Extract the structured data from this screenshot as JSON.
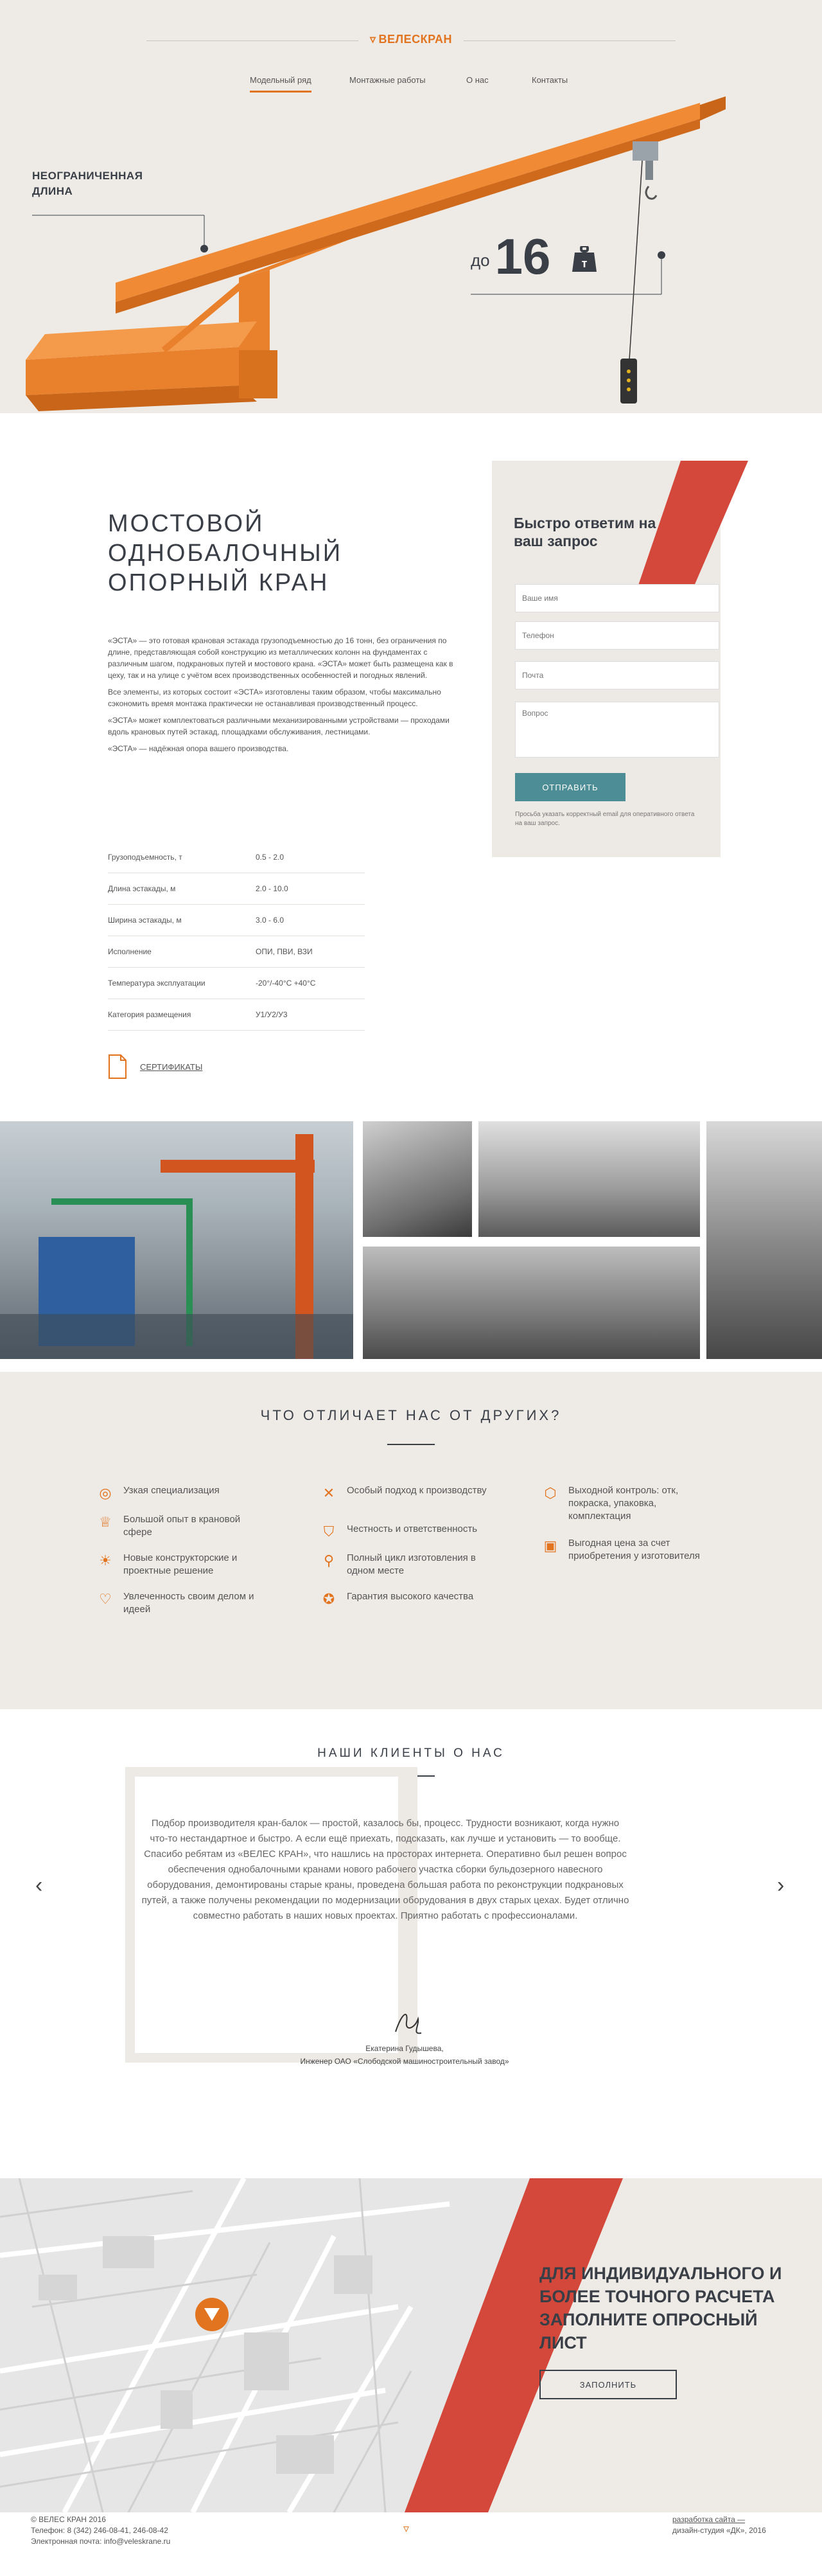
{
  "header": {
    "logo_text": "ВЕЛЕСКРАН",
    "nav": [
      "Модельный ряд",
      "Монтажные работы",
      "О нас",
      "Контакты"
    ]
  },
  "hero": {
    "callout_length": "НЕОГРАНИЧЕННАЯ ДЛИНА",
    "capacity_prefix": "до",
    "capacity_value": "16"
  },
  "product": {
    "title": "МОСТОВОЙ ОДНОБАЛОЧНЫЙ ОПОРНЫЙ КРАН",
    "paragraphs": [
      "«ЭСТА» — это готовая крановая эстакада грузоподъемностью до 16 тонн, без ограничения по длине, представляющая собой конструкцию из металлических колонн на фундаментах с различным шагом, подкрановых путей и мостового крана. «ЭСТА» может быть размещена как в цеху, так и на улице с учётом всех производственных особенностей и погодных явлений.",
      "Все элементы, из которых состоит «ЭСТА» изготовлены таким образом, чтобы максимально сэкономить время монтажа практически не останавливая производственный процесс.",
      "«ЭСТА» может комплектоваться различными механизированными устройствами — проходами вдоль крановых путей эстакад, площадками обслуживания, лестницами.",
      "«ЭСТА» — надёжная опора вашего производства."
    ],
    "specs": [
      {
        "k": "Грузоподъемность, т",
        "v": "0.5 - 2.0"
      },
      {
        "k": "Длина эстакады, м",
        "v": "2.0 - 10.0"
      },
      {
        "k": "Ширина эстакады, м",
        "v": "3.0 - 6.0"
      },
      {
        "k": "Исполнение",
        "v": "ОПИ, ПВИ, ВЗИ"
      },
      {
        "k": "Температура эксплуатации",
        "v": "-20°/-40°С +40°С"
      },
      {
        "k": "Категория размещения",
        "v": "У1/У2/У3"
      }
    ],
    "certificates_label": "СЕРТИФИКАТЫ"
  },
  "form": {
    "title": "Быстро ответим на ваш запрос",
    "name_placeholder": "Ваше имя",
    "phone_placeholder": "Телефон",
    "email_placeholder": "Почта",
    "question_placeholder": "Вопрос",
    "submit_label": "ОТПРАВИТЬ",
    "note": "Просьба указать корректный email для оперативного ответа на ваш запрос."
  },
  "features": {
    "title": "ЧТО ОТЛИЧАЕТ НАС ОТ ДРУГИХ?",
    "items": [
      {
        "text": "Узкая специализация",
        "icon": "target-icon"
      },
      {
        "text": "Большой опыт в крановой сфере",
        "icon": "medal-icon"
      },
      {
        "text": "Новые конструкторские и проектные решение",
        "icon": "bulb-icon"
      },
      {
        "text": "Увлеченность своим делом и идеей",
        "icon": "heart-icon"
      },
      {
        "text": "Особый подход к производству",
        "icon": "tools-icon"
      },
      {
        "text": "Честность и ответственность",
        "icon": "shield-icon"
      },
      {
        "text": "Полный цикл изготовления в одном месте",
        "icon": "location-icon"
      },
      {
        "text": "Гарантия высокого качества",
        "icon": "award-icon"
      },
      {
        "text": "Выходной контроль: отк, покраска, упаковка, комплектация",
        "icon": "box-icon"
      },
      {
        "text": "Выгодная цена за счет приобретения у изготовителя",
        "icon": "wallet-icon"
      }
    ]
  },
  "reviews": {
    "title": "НАШИ КЛИЕНТЫ О НАС",
    "text": "Подбор производителя кран-балок — простой, казалось бы, процесс. Трудности возникают, когда нужно что-то нестандартное и быстро. А если ещё приехать, подсказать, как лучше и установить — то вообще. Спасибо ребятам из «ВЕЛЕС КРАН», что нашлись на просторах интернета. Оперативно был решен вопрос обеспечения однобалочными кранами нового рабочего участка сборки бульдозерного навесного оборудования, демонтированы старые краны, проведена большая работа по реконструкции подкрановых путей, а также получены рекомендации по модернизации оборудования в двух старых цехах. Будет отлично совместно работать в наших новых проектах. Приятно работать с профессионалами.",
    "author_name": "Екатерина Гудышева,",
    "author_role": "Инженер ОАО «Слободской машиностроительный завод»"
  },
  "cta": {
    "text": "ДЛЯ ИНДИВИДУАЛЬНОГО И БОЛЕЕ ТОЧНОГО РАСЧЕТА ЗАПОЛНИТЕ ОПРОСНЫЙ ЛИСТ",
    "button": "ЗАПОЛНИТЬ"
  },
  "footer": {
    "copyright": "© ВЕЛЕС КРАН 2016",
    "phone": "Телефон: 8 (342) 246-08-41, 246-08-42",
    "email": "Электронная почта: info@veleskrane.ru",
    "dev_link": "разработка сайта —",
    "design": "дизайн-студия «ДК», 2016"
  },
  "colors": {
    "accent_orange": "#e2731f",
    "accent_red": "#d4483b",
    "teal_button": "#4d8d96",
    "beige_bg": "#eeebe7"
  }
}
